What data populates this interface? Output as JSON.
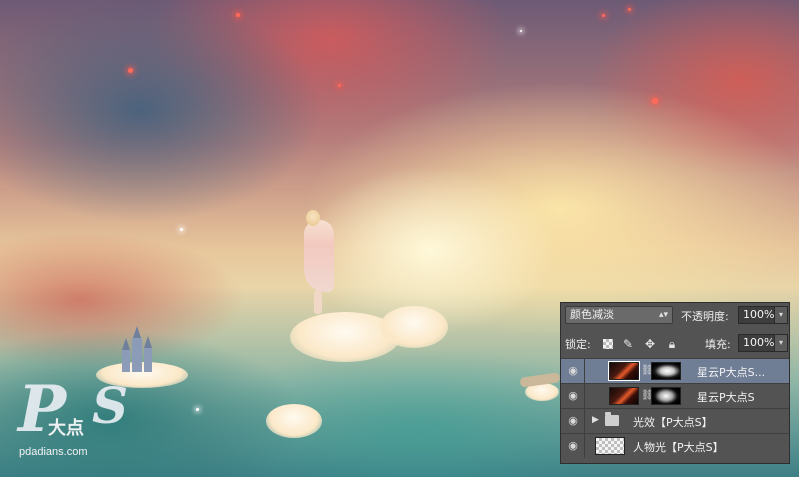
{
  "watermark": {
    "logo_letters": "PS",
    "logo_chinese": "大点",
    "site": "pdadians.com"
  },
  "layers_panel": {
    "blend_mode": "颜色减淡",
    "opacity_label": "不透明度:",
    "opacity_value": "100%",
    "lock_label": "锁定:",
    "fill_label": "填充:",
    "fill_value": "100%",
    "layers": [
      {
        "name": "星云P大点S...",
        "type": "layer-with-mask",
        "selected": true
      },
      {
        "name": "星云P大点S",
        "type": "layer-with-mask",
        "selected": false
      },
      {
        "name": "光效【P大点S】",
        "type": "group",
        "selected": false
      },
      {
        "name": "人物光【P大点S】",
        "type": "layer",
        "selected": false
      }
    ]
  },
  "colors": {
    "panel_bg": "#535353",
    "selected_row": "#6f7d95"
  }
}
